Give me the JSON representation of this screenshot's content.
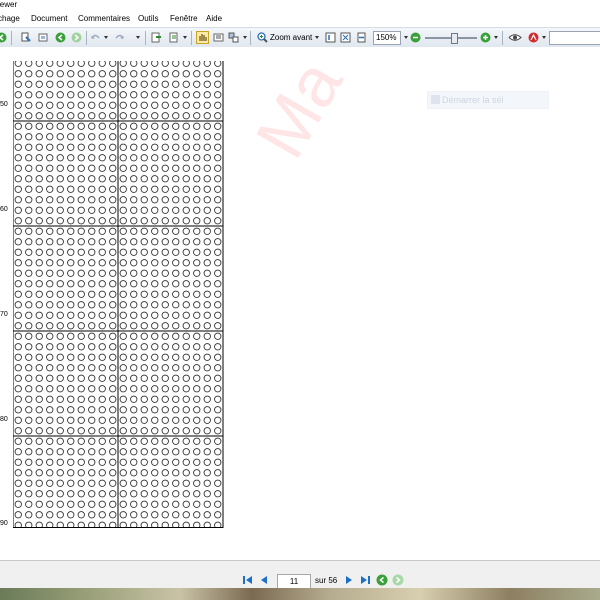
{
  "window": {
    "title": "iewer"
  },
  "menu": [
    "chage",
    "Document",
    "Commentaires",
    "Outils",
    "Fenêtre",
    "Aide"
  ],
  "toolbar": {
    "zoom_in_label": "Zoom avant",
    "zoom_value": "150%",
    "search_placeholder": ""
  },
  "page_overlay": {
    "ghost_button": "Démarrer la sél"
  },
  "watermark": "Ma",
  "row_labels": [
    "50",
    "60",
    "70",
    "80",
    "90"
  ],
  "chart_pattern": {
    "columns_per_block": 10,
    "blocks_across": 2,
    "rows_per_block": 10,
    "blocks_down": 5
  },
  "navigation": {
    "current_page": "11",
    "total_label": "sur 56"
  },
  "colors": {
    "toolbar_bg": "#dfe6ee",
    "nav_blue": "#1e6fc8",
    "nav_green": "#3aa03a",
    "watermark_red": "#ff0000"
  }
}
